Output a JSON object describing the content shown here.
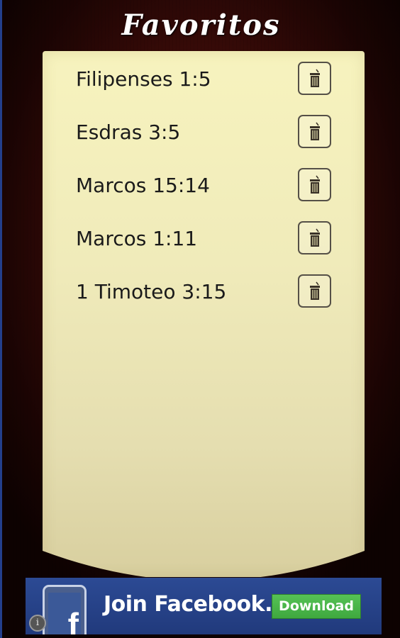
{
  "header": {
    "title": "Favoritos"
  },
  "favorites": [
    {
      "label": "Filipenses 1:5",
      "action_icon": "trash-icon"
    },
    {
      "label": "Esdras 3:5",
      "action_icon": "trash-icon"
    },
    {
      "label": "Marcos 15:14",
      "action_icon": "trash-icon"
    },
    {
      "label": "Marcos 1:11",
      "action_icon": "trash-icon"
    },
    {
      "label": "1 Timoteo 3:15",
      "action_icon": "trash-icon"
    }
  ],
  "ad": {
    "text": "Join Facebook.",
    "button_label": "Download",
    "logo_letter": "f",
    "info_glyph": "i",
    "brand_color": "#3b5998",
    "button_color": "#4cb84c"
  },
  "colors": {
    "background": "#3a0b08",
    "scroll": "#f2eebb",
    "text": "#1a1a1a",
    "title": "#ffffff"
  }
}
